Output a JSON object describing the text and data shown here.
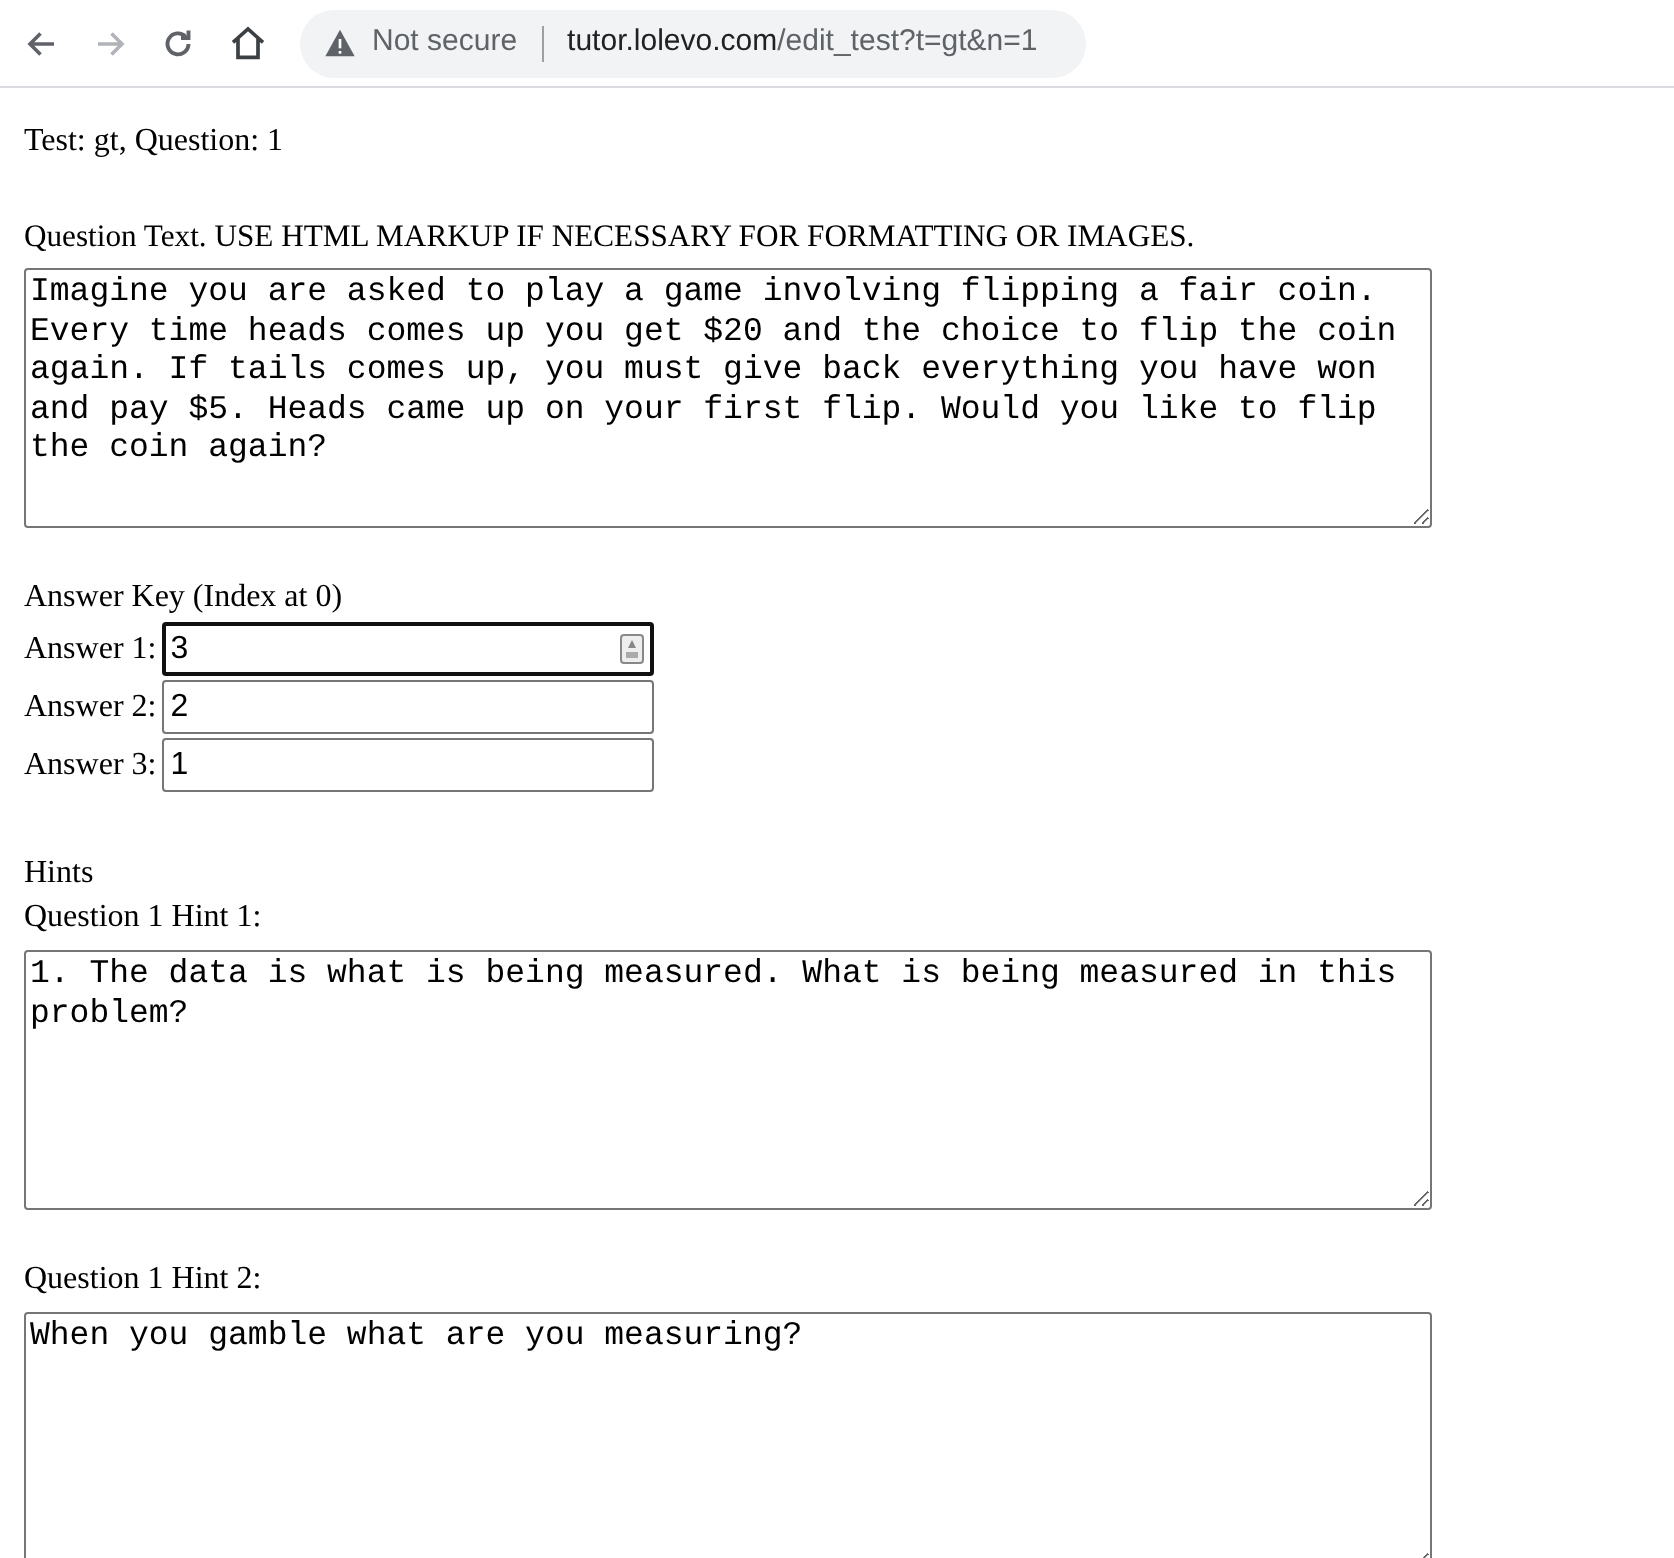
{
  "browser": {
    "security": "Not secure",
    "url_host": "tutor.lolevo.com",
    "url_path": "/edit_test?t=gt&n=1"
  },
  "heading": "Test: gt, Question: 1",
  "question": {
    "label": "Question Text. USE HTML MARKUP IF NECESSARY FOR FORMATTING OR IMAGES.",
    "value": "Imagine you are asked to play a game involving flipping a fair coin. Every time heads comes up you get $20 and the choice to flip the coin again. If tails comes up, you must give back everything you have won and pay $5. Heads came up on your first flip. Would you like to flip the coin again?"
  },
  "answer_key": {
    "title": "Answer Key (Index at 0)",
    "answers": [
      {
        "label": "Answer 1:",
        "value": "3",
        "focused": true
      },
      {
        "label": "Answer 2:",
        "value": "2",
        "focused": false
      },
      {
        "label": "Answer 3:",
        "value": "1",
        "focused": false
      }
    ]
  },
  "hints": {
    "title": "Hints",
    "items": [
      {
        "label": "Question 1 Hint 1:",
        "value": "1. The data is what is being measured. What is being measured in this problem?"
      },
      {
        "label": "Question 1 Hint 2:",
        "value": "When you gamble what are you measuring?"
      }
    ]
  }
}
